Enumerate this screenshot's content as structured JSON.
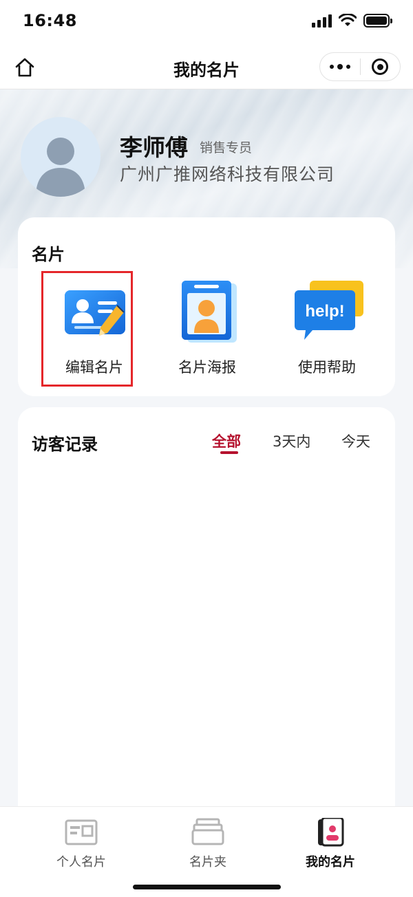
{
  "status_bar": {
    "time": "16:48"
  },
  "nav": {
    "title": "我的名片"
  },
  "profile": {
    "name": "李师傅",
    "role": "销售专员",
    "company": "广州广推网络科技有限公司"
  },
  "card_section": {
    "title": "名片",
    "items": [
      {
        "label": "编辑名片",
        "icon": "edit-card-icon"
      },
      {
        "label": "名片海报",
        "icon": "card-poster-icon"
      },
      {
        "label": "使用帮助",
        "icon": "help-icon",
        "icon_text": "help!"
      }
    ],
    "highlight_color": "#e5262a"
  },
  "visitor_section": {
    "title": "访客记录",
    "tabs": [
      {
        "label": "全部",
        "active": true
      },
      {
        "label": "3天内",
        "active": false
      },
      {
        "label": "今天",
        "active": false
      }
    ],
    "accent": "#b5122e"
  },
  "tabbar": {
    "items": [
      {
        "label": "个人名片",
        "icon": "id-card-icon",
        "active": false
      },
      {
        "label": "名片夹",
        "icon": "card-holder-icon",
        "active": false
      },
      {
        "label": "我的名片",
        "icon": "my-card-icon",
        "active": true
      }
    ]
  }
}
